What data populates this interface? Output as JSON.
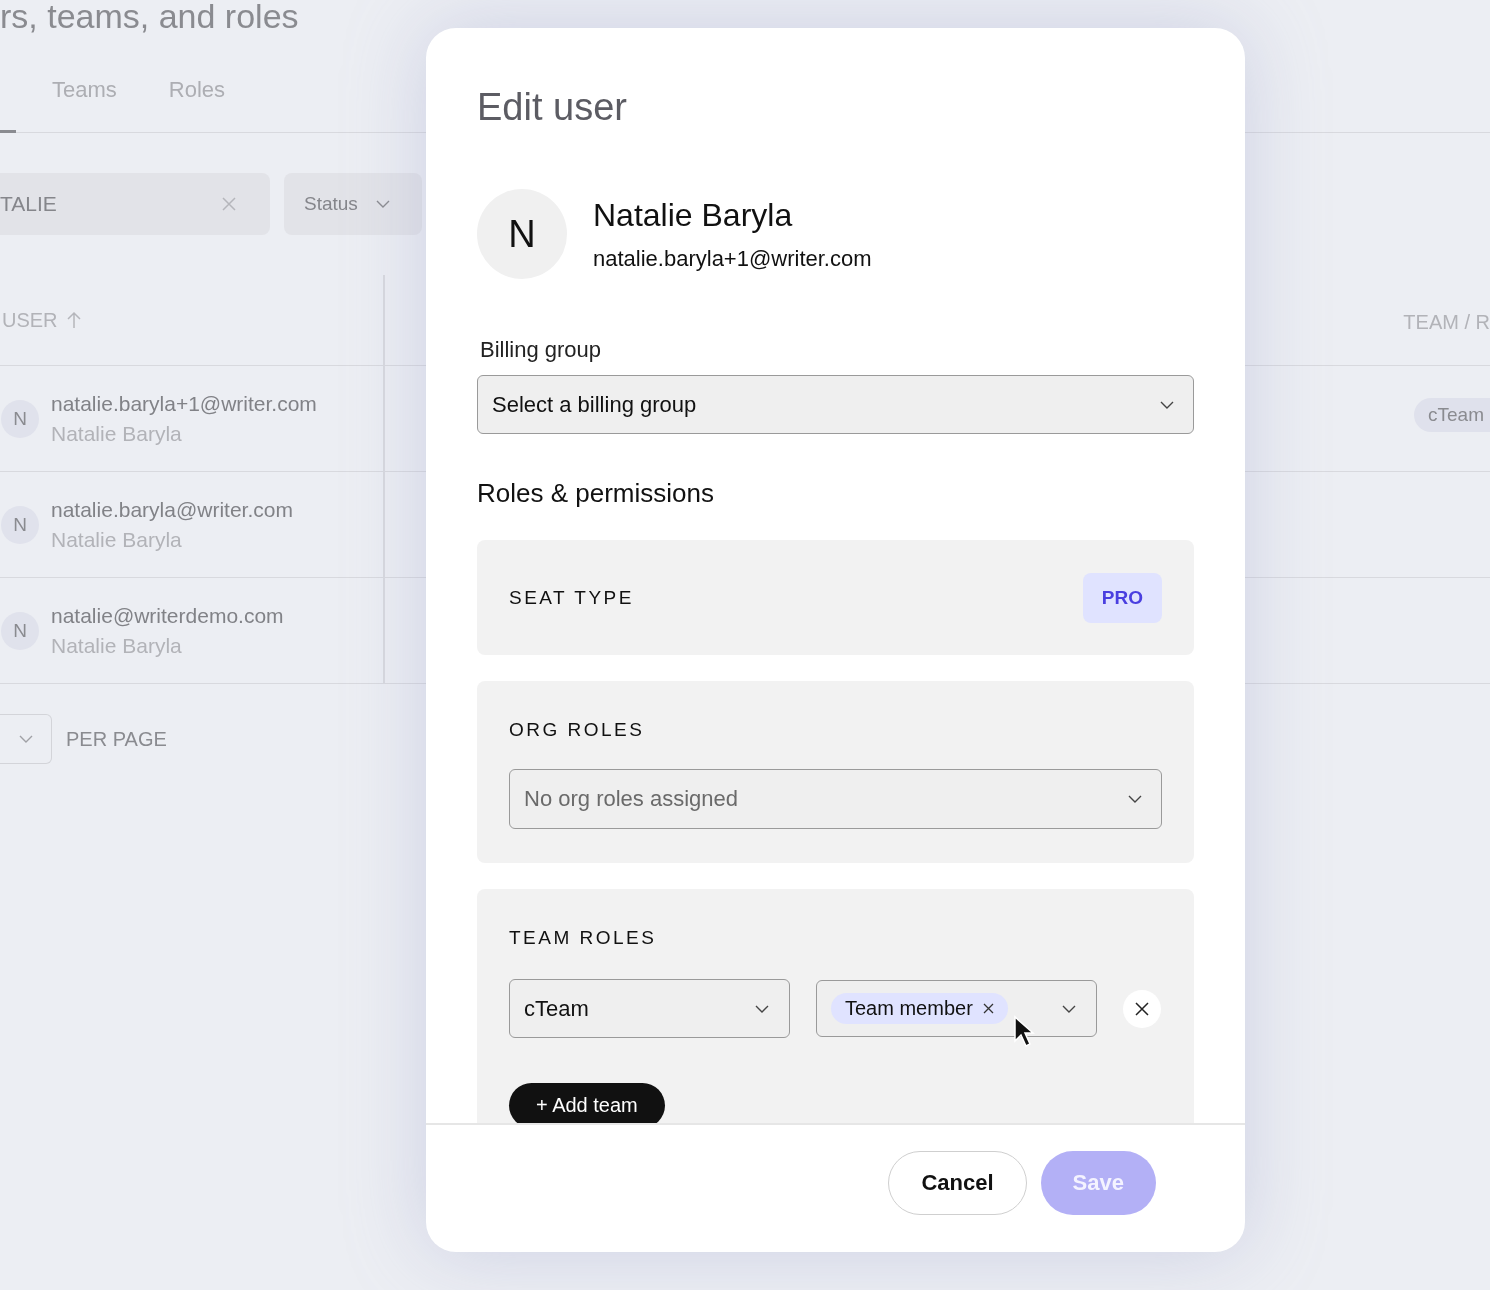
{
  "background": {
    "page_title": "rs, teams, and roles",
    "tabs": [
      {
        "label": "Teams",
        "selected": false
      },
      {
        "label": "Roles",
        "selected": false
      }
    ],
    "search": {
      "value": "TALIE"
    },
    "status_filter": {
      "label": "Status"
    },
    "table": {
      "columns": [
        "USER",
        "TEAM / R"
      ],
      "rows": [
        {
          "avatar": "N",
          "email": "natalie.baryla+1@writer.com",
          "name": "Natalie Baryla",
          "team": "cTeam"
        },
        {
          "avatar": "N",
          "email": "natalie.baryla@writer.com",
          "name": "Natalie Baryla"
        },
        {
          "avatar": "N",
          "email": "natalie@writerdemo.com",
          "name": "Natalie Baryla"
        }
      ]
    },
    "pagination": {
      "label": "PER PAGE"
    }
  },
  "modal": {
    "title": "Edit user",
    "user": {
      "initial": "N",
      "name": "Natalie Baryla",
      "email": "natalie.baryla+1@writer.com"
    },
    "billing_group": {
      "label": "Billing group",
      "placeholder": "Select a billing group"
    },
    "section_title": "Roles & permissions",
    "seat_type": {
      "label": "SEAT TYPE",
      "badge": "PRO"
    },
    "org_roles": {
      "label": "ORG ROLES",
      "placeholder": "No org roles assigned"
    },
    "team_roles": {
      "label": "TEAM ROLES",
      "rows": [
        {
          "team": "cTeam",
          "roles": [
            "Team member"
          ]
        }
      ],
      "add_button": "+ Add team"
    },
    "buttons": [
      {
        "label": "Cancel",
        "kind": "secondary",
        "disabled": false
      },
      {
        "label": "Save",
        "kind": "primary",
        "disabled": true
      }
    ]
  }
}
